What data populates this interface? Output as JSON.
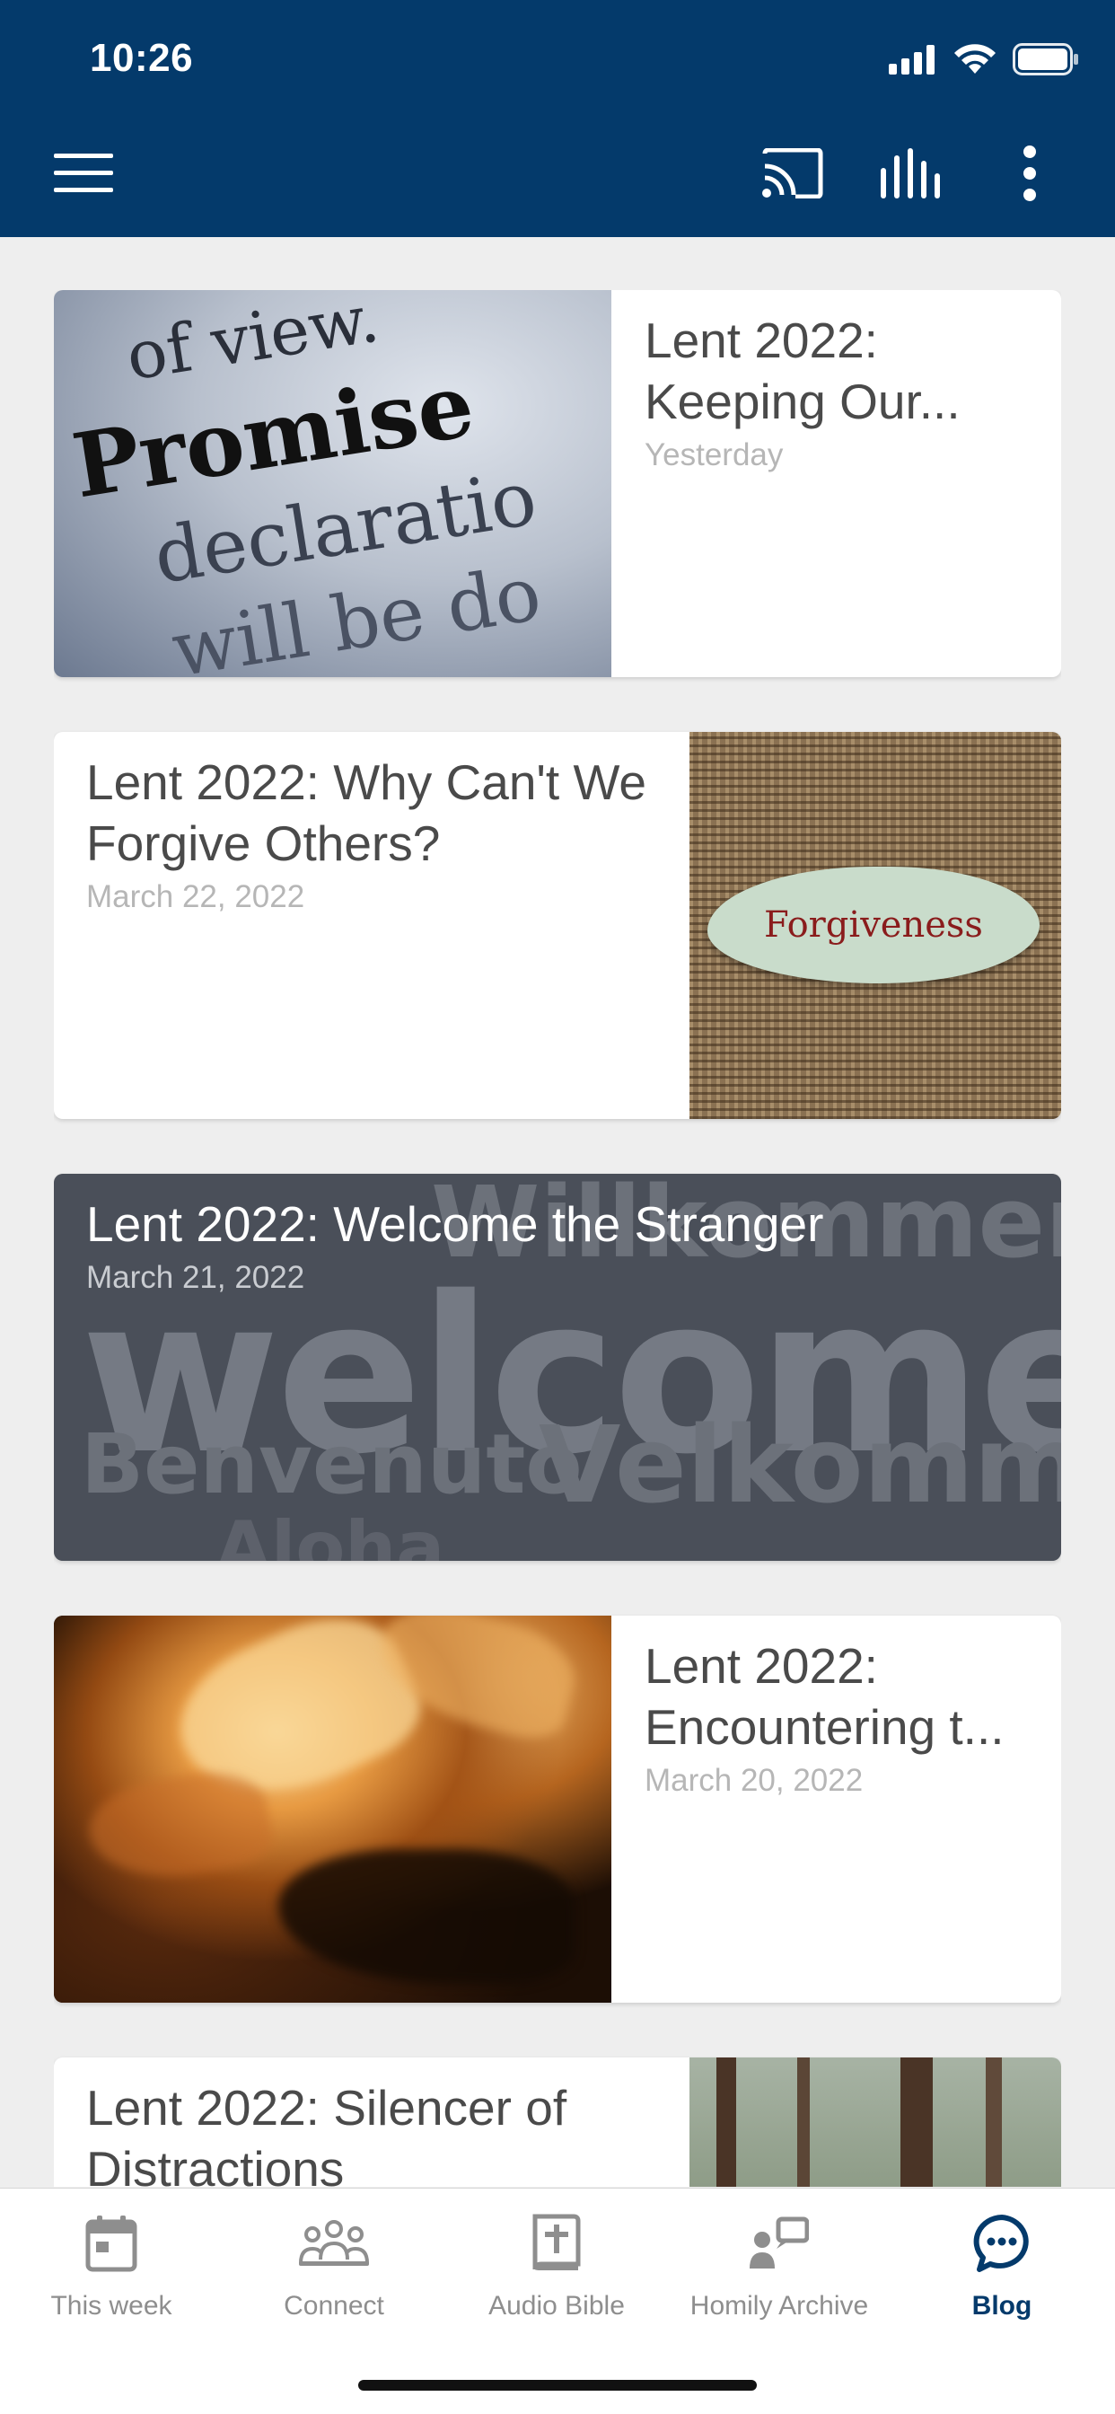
{
  "status_bar": {
    "time": "10:26"
  },
  "colors": {
    "header": "#043a6b",
    "accent": "#043a6b",
    "inactive": "#8e8e8e"
  },
  "toolbar": {
    "menu_icon": "hamburger-menu-icon",
    "cast_icon": "cast-icon",
    "audio_icon": "audio-bars-icon",
    "more_icon": "more-vertical-icon"
  },
  "posts": [
    {
      "title": "Lent 2022: Keeping Our...",
      "date": "Yesterday",
      "image_text": [
        "of view.",
        "Promise",
        "declaratio",
        "will be do"
      ]
    },
    {
      "title": "Lent 2022: Why Can't We Forgive Others?",
      "date": "March 22, 2022",
      "image_text": [
        "Forgiveness"
      ]
    },
    {
      "title": "Lent 2022: Welcome the Stranger",
      "date": "March 21, 2022",
      "image_text": [
        "Willkommen",
        "welcome",
        "Benvenuto",
        "Velkomme",
        "Aloha"
      ]
    },
    {
      "title": "Lent 2022: Encountering t...",
      "date": "March 20, 2022"
    },
    {
      "title": "Lent 2022: Silencer of Distractions",
      "date": ""
    }
  ],
  "tabs": [
    {
      "label": "This week",
      "icon": "calendar-icon",
      "active": false
    },
    {
      "label": "Connect",
      "icon": "people-group-icon",
      "active": false
    },
    {
      "label": "Audio Bible",
      "icon": "bible-cross-icon",
      "active": false
    },
    {
      "label": "Homily Archive",
      "icon": "speaker-person-icon",
      "active": false
    },
    {
      "label": "Blog",
      "icon": "chat-bubble-icon",
      "active": true
    }
  ]
}
